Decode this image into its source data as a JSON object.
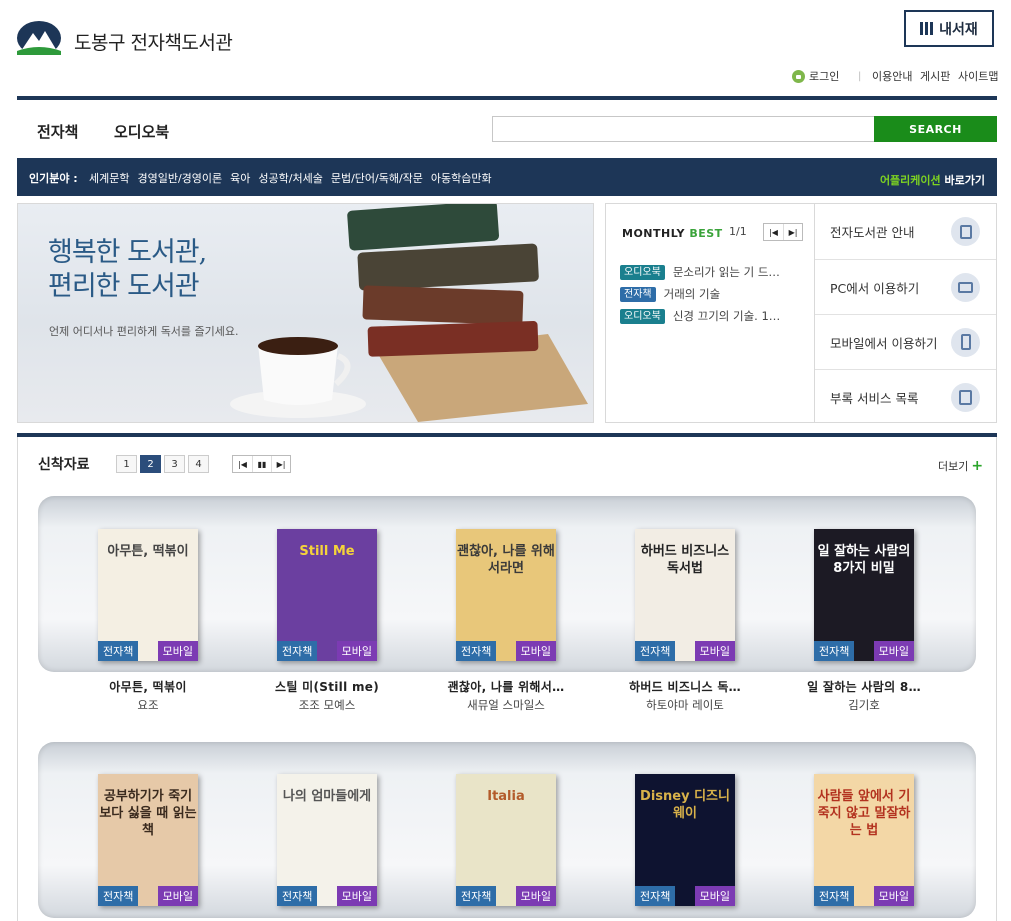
{
  "header": {
    "site_title": "도봉구 전자책도서관",
    "mylib_label": "내서재",
    "util_links": [
      "로그인",
      "이용안내",
      "게시판",
      "사이트맵"
    ]
  },
  "nav": {
    "tabs": [
      "전자책",
      "오디오북"
    ],
    "search_placeholder": "",
    "search_button": "SEARCH"
  },
  "popular": {
    "label": "인기분야 :",
    "items": [
      "세계문학",
      "경영일반/경영이론",
      "육아",
      "성공학/처세술",
      "문법/단어/독해/작문",
      "아동학습만화"
    ],
    "app_highlight": "어플리케이션",
    "app_rest": "바로가기"
  },
  "banner": {
    "title_line1": "행복한 도서관,",
    "title_line2": "편리한 도서관",
    "subtitle": "언제 어디서나 편리하게 독서를 즐기세요."
  },
  "monthly_best": {
    "head_a": "MONTHLY",
    "head_b": "BEST",
    "page": "1/1",
    "items": [
      {
        "tag": "오디오북",
        "kind": "audio",
        "title": "문소리가 읽는 기 드…"
      },
      {
        "tag": "전자책",
        "kind": "ebook",
        "title": "거래의 기술"
      },
      {
        "tag": "오디오북",
        "kind": "audio",
        "title": "신경 끄기의 기술. 1…"
      }
    ]
  },
  "quick_links": [
    {
      "label": "전자도서관 안내",
      "icon": "guide-icon"
    },
    {
      "label": "PC에서 이용하기",
      "icon": "monitor-icon"
    },
    {
      "label": "모바일에서 이용하기",
      "icon": "mobile-icon"
    },
    {
      "label": "부록 서비스 목록",
      "icon": "list-icon"
    }
  ],
  "new_arrivals": {
    "title": "신착자료",
    "pages": [
      "1",
      "2",
      "3",
      "4"
    ],
    "current_page": "2",
    "more_label": "더보기",
    "badge_ebook": "전자책",
    "badge_mobile": "모바일",
    "row1": [
      {
        "title": "아무튼, 떡볶이",
        "author": "요조",
        "cover_text": "아무튼, 떡볶이",
        "cover_bg": "#f4efe3",
        "cover_fg": "#444"
      },
      {
        "title": "스틸 미(Still me)",
        "author": "조조 모예스",
        "cover_text": "Still Me",
        "cover_bg": "#6b3fa0",
        "cover_fg": "#f5d33a"
      },
      {
        "title": "괜찮아, 나를 위해서…",
        "author": "새뮤얼 스마일스",
        "cover_text": "괜찮아, 나를 위해서라면",
        "cover_bg": "#e8c77a",
        "cover_fg": "#3a3a3a"
      },
      {
        "title": "하버드 비즈니스 독…",
        "author": "하토야마 레이토",
        "cover_text": "하버드 비즈니스 독서법",
        "cover_bg": "#f2ede4",
        "cover_fg": "#222"
      },
      {
        "title": "일 잘하는 사람의 8…",
        "author": "김기호",
        "cover_text": "일 잘하는 사람의 8가지 비밀",
        "cover_bg": "#1c1a24",
        "cover_fg": "#ffffff"
      }
    ],
    "row2": [
      {
        "cover_text": "공부하기가 죽기보다 싫을 때 읽는 책",
        "cover_bg": "#e6c9a8",
        "cover_fg": "#3a2a1e"
      },
      {
        "cover_text": "나의 엄마들에게",
        "cover_bg": "#f4f2ea",
        "cover_fg": "#555"
      },
      {
        "cover_text": "Italia",
        "cover_bg": "#e9e4c8",
        "cover_fg": "#b35b2a"
      },
      {
        "cover_text": "Disney 디즈니 웨이",
        "cover_bg": "#0e1330",
        "cover_fg": "#d9b24a"
      },
      {
        "cover_text": "사람들 앞에서 기죽지 않고 말잘하는 법",
        "cover_bg": "#f3d7a6",
        "cover_fg": "#b3321f"
      }
    ]
  }
}
